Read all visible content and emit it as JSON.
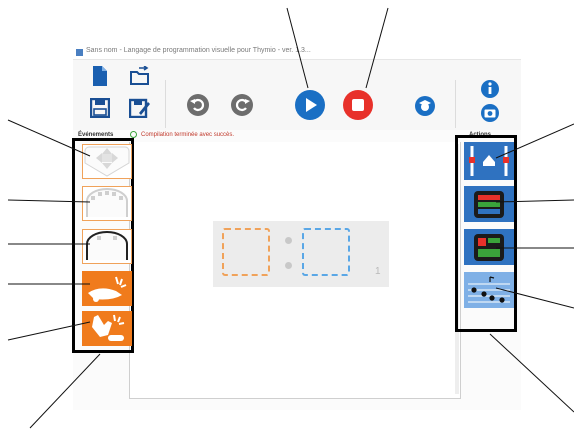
{
  "window": {
    "title": "Sans nom - Langage de programmation visuelle pour Thymio - ver. 1.3.1",
    "title_visible": "Sans nom - Langage de programmation visuelle pour Thymio - ver. 1.3..."
  },
  "toolbar": {
    "buttons": [
      {
        "name": "new-file",
        "icon": "new-file-icon"
      },
      {
        "name": "open-file",
        "icon": "open-folder-icon"
      },
      {
        "name": "save",
        "icon": "save-icon"
      },
      {
        "name": "save-as",
        "icon": "save-as-icon"
      },
      {
        "name": "undo",
        "icon": "undo-icon"
      },
      {
        "name": "redo",
        "icon": "redo-icon"
      },
      {
        "name": "run",
        "icon": "play-icon"
      },
      {
        "name": "stop",
        "icon": "stop-icon"
      },
      {
        "name": "advanced-mode",
        "icon": "student-icon"
      },
      {
        "name": "help",
        "icon": "info-icon"
      },
      {
        "name": "screenshot",
        "icon": "camera-icon"
      }
    ]
  },
  "events_label": "Événements",
  "status_text": "Compilation terminée avec succès.",
  "actions_label": "Actions",
  "events": [
    {
      "name": "buttons-event",
      "icon": "arrow-buttons-icon"
    },
    {
      "name": "front-proximity-event",
      "icon": "front-sensors-icon"
    },
    {
      "name": "ground-proximity-event",
      "icon": "ground-sensors-icon"
    },
    {
      "name": "tap-event",
      "icon": "tap-icon"
    },
    {
      "name": "clap-event",
      "icon": "clap-icon"
    }
  ],
  "actions": [
    {
      "name": "motors-action",
      "icon": "motors-icon"
    },
    {
      "name": "top-color-action",
      "icon": "top-color-icon"
    },
    {
      "name": "bottom-color-action",
      "icon": "bottom-color-icon"
    },
    {
      "name": "music-action",
      "icon": "music-icon"
    }
  ],
  "rule": {
    "number": "1"
  },
  "colors": {
    "accent_blue": "#1a6fc4",
    "stop_red": "#e8312a",
    "event_orange": "#f07b1c",
    "panel_border": "#000000",
    "action_tile_blue": "#2f72c0"
  }
}
